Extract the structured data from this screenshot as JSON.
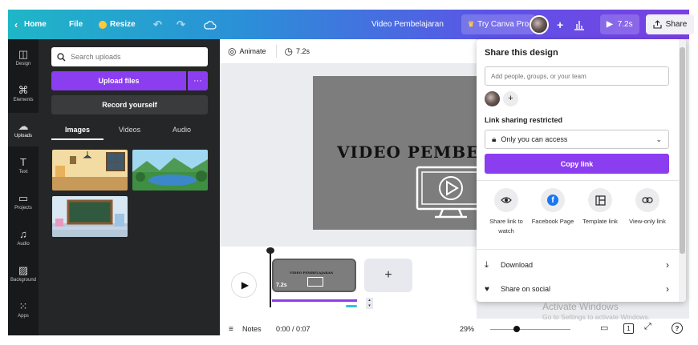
{
  "topbar": {
    "home": "Home",
    "file": "File",
    "resize": "Resize",
    "title": "Video Pembelajaran",
    "try_pro": "Try Canva Pro",
    "duration": "7.2s",
    "share": "Share"
  },
  "rail": {
    "items": [
      {
        "label": "Design",
        "icon": "design-icon"
      },
      {
        "label": "Elements",
        "icon": "elements-icon"
      },
      {
        "label": "Uploads",
        "icon": "upload-cloud-icon"
      },
      {
        "label": "Text",
        "icon": "text-icon"
      },
      {
        "label": "Projects",
        "icon": "folder-icon"
      },
      {
        "label": "Audio",
        "icon": "music-icon"
      },
      {
        "label": "Background",
        "icon": "background-icon"
      },
      {
        "label": "Apps",
        "icon": "apps-icon"
      }
    ]
  },
  "uploads": {
    "search_placeholder": "Search uploads",
    "upload_files": "Upload files",
    "more": "···",
    "record": "Record yourself",
    "tabs": [
      "Images",
      "Videos",
      "Audio"
    ]
  },
  "canvas": {
    "animate": "Animate",
    "duration": "7.2s",
    "slide_title": "VIDEO PEMBE"
  },
  "timeline": {
    "clip_duration": "7.2s",
    "clip_title": "VIDEO PEMBELAJARAN",
    "add": "+"
  },
  "bottombar": {
    "notes": "Notes",
    "time": "0:00 / 0:07",
    "zoom": "29%",
    "page_count": "1",
    "help": "?"
  },
  "share_popup": {
    "title": "Share this design",
    "people_placeholder": "Add people, groups, or your team",
    "add_person": "+",
    "link_label": "Link sharing restricted",
    "access": "Only you can access",
    "copy_link": "Copy link",
    "options": [
      {
        "label": "Share link to watch",
        "icon": "eye-icon"
      },
      {
        "label": "Facebook Page",
        "icon": "facebook-icon"
      },
      {
        "label": "Template link",
        "icon": "template-icon"
      },
      {
        "label": "View-only link",
        "icon": "link-icon"
      }
    ],
    "download": "Download",
    "share_social": "Share on social"
  },
  "watermark": {
    "line1": "Activate Windows",
    "line2": "Go to Settings to activate Windows."
  },
  "colors": {
    "accent": "#8b3df0",
    "rail_bg": "#18191b",
    "panel_bg": "#252627"
  }
}
